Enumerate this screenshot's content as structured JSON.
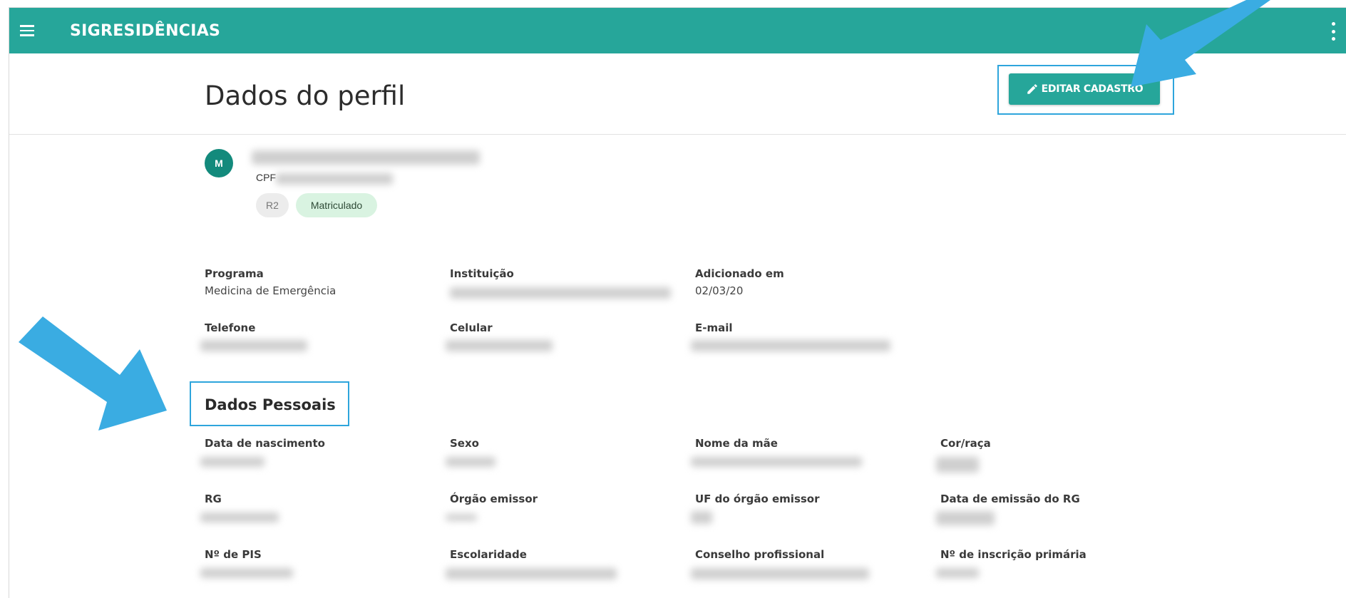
{
  "app": {
    "title": "SIGRESIDÊNCIAS"
  },
  "icons": {
    "menu": "hamburger-menu-icon",
    "more": "more-vert-icon",
    "edit": "pencil-icon"
  },
  "colors": {
    "primary": "#26a69a",
    "avatar": "#138a7c",
    "highlight": "#2ea5dc",
    "arrow": "#3aace2"
  },
  "header": {
    "page_title": "Dados do perfil",
    "edit_button": "EDITAR CADASTRO"
  },
  "profile": {
    "avatar_initial": "M",
    "cpf_label": "CPF",
    "chips": {
      "year": "R2",
      "status": "Matriculado"
    }
  },
  "summary": {
    "program_label": "Programa",
    "program_value": "Medicina de Emergência",
    "institution_label": "Instituição",
    "added_label": "Adicionado em",
    "added_value": "02/03/20",
    "phone_label": "Telefone",
    "cell_label": "Celular",
    "email_label": "E-mail"
  },
  "personal": {
    "title": "Dados Pessoais",
    "fields": [
      "Data de nascimento",
      "Sexo",
      "Nome da mãe",
      "Cor/raça",
      "RG",
      "Órgão emissor",
      "UF do órgão emissor",
      "Data de emissão do RG",
      "Nº de PIS",
      "Escolaridade",
      "Conselho profissional",
      "Nº de inscrição primária"
    ]
  }
}
